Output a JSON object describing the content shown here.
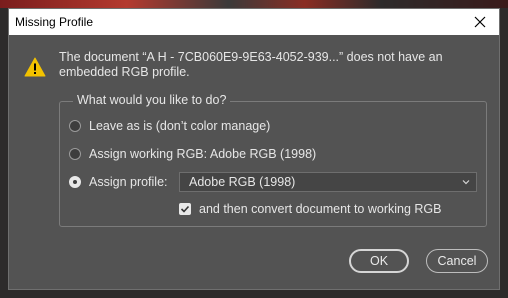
{
  "dialog": {
    "title": "Missing Profile",
    "message_line1": "The document “A H - 7CB060E9-9E63-4052-939...” does not have an",
    "message_line2": "embedded RGB profile.",
    "group_title": "What would you like to do?",
    "options": [
      {
        "label": "Leave as is (don’t color manage)",
        "selected": false
      },
      {
        "label": "Assign working RGB:  Adobe RGB (1998)",
        "selected": false
      },
      {
        "label": "Assign profile:",
        "selected": true
      }
    ],
    "profile_select_value": "Adobe RGB (1998)",
    "convert_checkbox_label": "and then convert document to working RGB",
    "convert_checked": true,
    "ok_label": "OK",
    "cancel_label": "Cancel"
  },
  "colors": {
    "dialog_bg": "#535353",
    "titlebar_bg": "#ffffff",
    "warning_yellow": "#f2c200"
  },
  "icons": {
    "close": "close-icon",
    "warning": "warning-icon",
    "dropdown": "chevron-down-icon",
    "check": "checkmark-icon"
  }
}
